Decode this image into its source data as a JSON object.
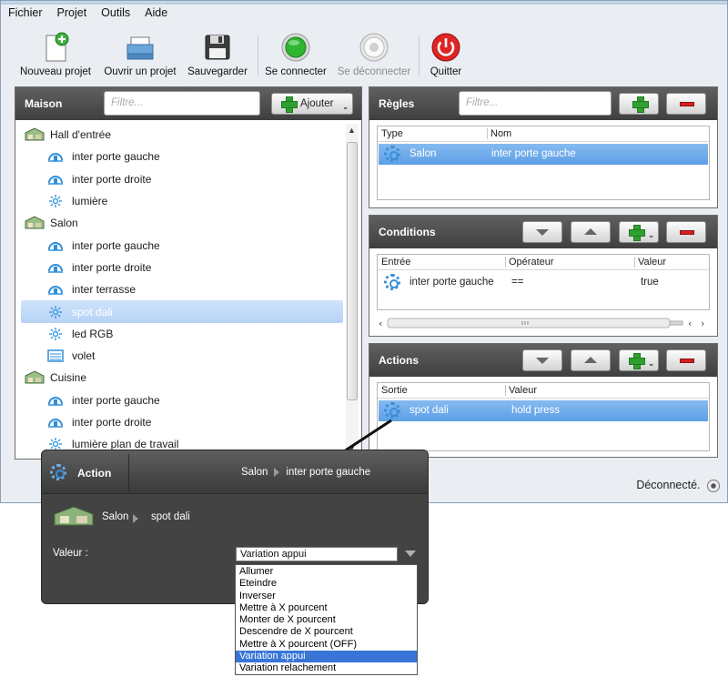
{
  "menu": [
    "Fichier",
    "Projet",
    "Outils",
    "Aide"
  ],
  "toolbar": {
    "new": "Nouveau projet",
    "open": "Ouvrir un projet",
    "save": "Sauvegarder",
    "connect": "Se connecter",
    "disconnect": "Se déconnecter",
    "quit": "Quitter"
  },
  "maison": {
    "title": "Maison",
    "filter_placeholder": "Filtre...",
    "add_label": "Ajouter",
    "tree": [
      {
        "type": "room",
        "label": "Hall d'entrée",
        "icon": "room-icon"
      },
      {
        "type": "child",
        "label": "inter porte gauche",
        "icon": "switch-icon"
      },
      {
        "type": "child",
        "label": "inter porte droite",
        "icon": "switch-icon"
      },
      {
        "type": "child",
        "label": "lumière",
        "icon": "light-icon"
      },
      {
        "type": "room",
        "label": "Salon",
        "icon": "room-icon"
      },
      {
        "type": "child",
        "label": "inter porte gauche",
        "icon": "switch-icon"
      },
      {
        "type": "child",
        "label": "inter porte droite",
        "icon": "switch-icon"
      },
      {
        "type": "child",
        "label": "inter terrasse",
        "icon": "switch-icon"
      },
      {
        "type": "child",
        "label": "spot dali",
        "icon": "light-icon",
        "selected": true
      },
      {
        "type": "child",
        "label": "led RGB",
        "icon": "light-icon"
      },
      {
        "type": "child",
        "label": "volet",
        "icon": "shutter-icon"
      },
      {
        "type": "room",
        "label": "Cuisine",
        "icon": "room-icon"
      },
      {
        "type": "child",
        "label": "inter porte gauche",
        "icon": "switch-icon"
      },
      {
        "type": "child",
        "label": "inter porte droite",
        "icon": "switch-icon"
      },
      {
        "type": "child",
        "label": "lumière plan de travail",
        "icon": "light-icon"
      }
    ]
  },
  "regles": {
    "title": "Règles",
    "filter_placeholder": "Filtre...",
    "columns": [
      "Type",
      "Nom"
    ],
    "rows": [
      {
        "type": "Salon",
        "name": "inter porte gauche"
      }
    ]
  },
  "conditions": {
    "title": "Conditions",
    "columns": [
      "Entrée",
      "Opérateur",
      "Valeur"
    ],
    "rows": [
      {
        "input": "inter porte gauche",
        "operator": "==",
        "value": "true"
      }
    ]
  },
  "actions": {
    "title": "Actions",
    "columns": [
      "Sortie",
      "Valeur"
    ],
    "rows": [
      {
        "output": "spot dali",
        "value": "hold press"
      }
    ]
  },
  "status": {
    "text": "Déconnecté."
  },
  "popup": {
    "title": "Action",
    "crumb_room": "Salon",
    "crumb_item": "inter porte gauche",
    "target_room": "Salon",
    "target_item": "spot dali",
    "value_label": "Valeur :",
    "selected": "Variation appui",
    "options": [
      "Allumer",
      "Eteindre",
      "Inverser",
      "Mettre à X pourcent",
      "Monter de X pourcent",
      "Descendre de X pourcent",
      "Mettre à X pourcent (OFF)",
      "Variation appui",
      "Variation relachement"
    ]
  }
}
